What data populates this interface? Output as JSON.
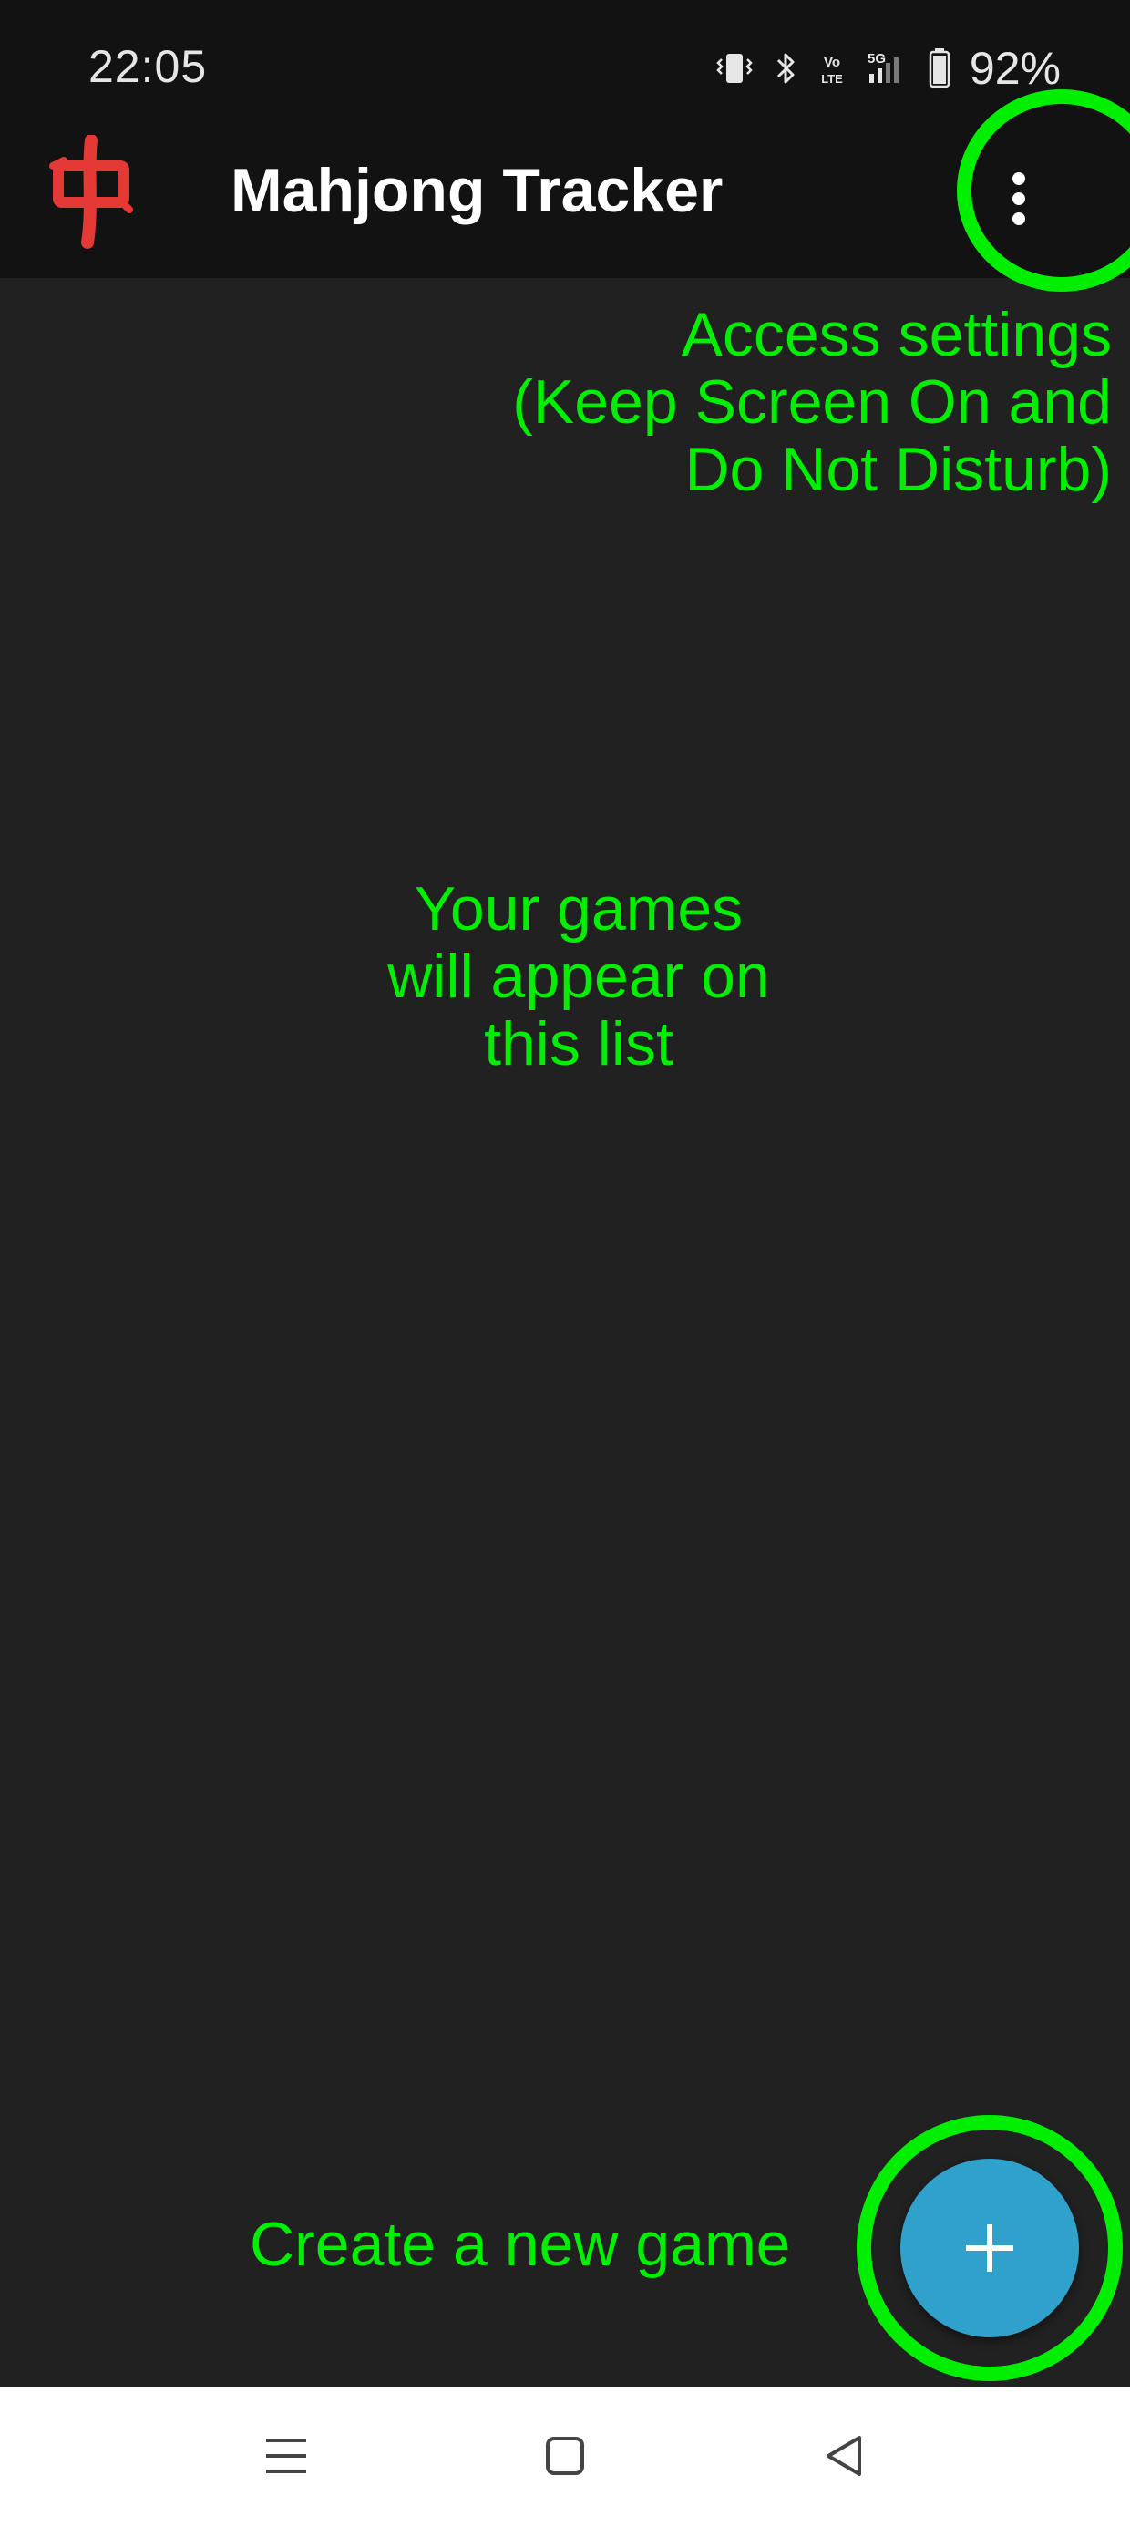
{
  "status_bar": {
    "time": "22:05",
    "battery_percent": "92%",
    "icons": [
      "vibrate-icon",
      "bluetooth-icon",
      "volte-icon",
      "5g-signal-icon",
      "battery-icon"
    ]
  },
  "app_bar": {
    "logo_glyph": "中",
    "title": "Mahjong Tracker",
    "menu_icon": "more-vert-icon"
  },
  "hints": {
    "settings_lines": [
      "Access settings",
      "(Keep Screen On and",
      "Do Not Disturb)"
    ],
    "list_lines": [
      "Your games",
      "will appear on",
      "this list"
    ],
    "create": "Create a new game"
  },
  "fab": {
    "icon": "plus-icon"
  },
  "nav_bar": {
    "buttons": [
      "recent-apps-icon",
      "home-icon",
      "back-icon"
    ]
  },
  "colors": {
    "background": "#212121",
    "app_bar": "#121212",
    "highlight": "#00ee00",
    "fab": "#2fa1cb",
    "logo_red": "#e53935"
  }
}
